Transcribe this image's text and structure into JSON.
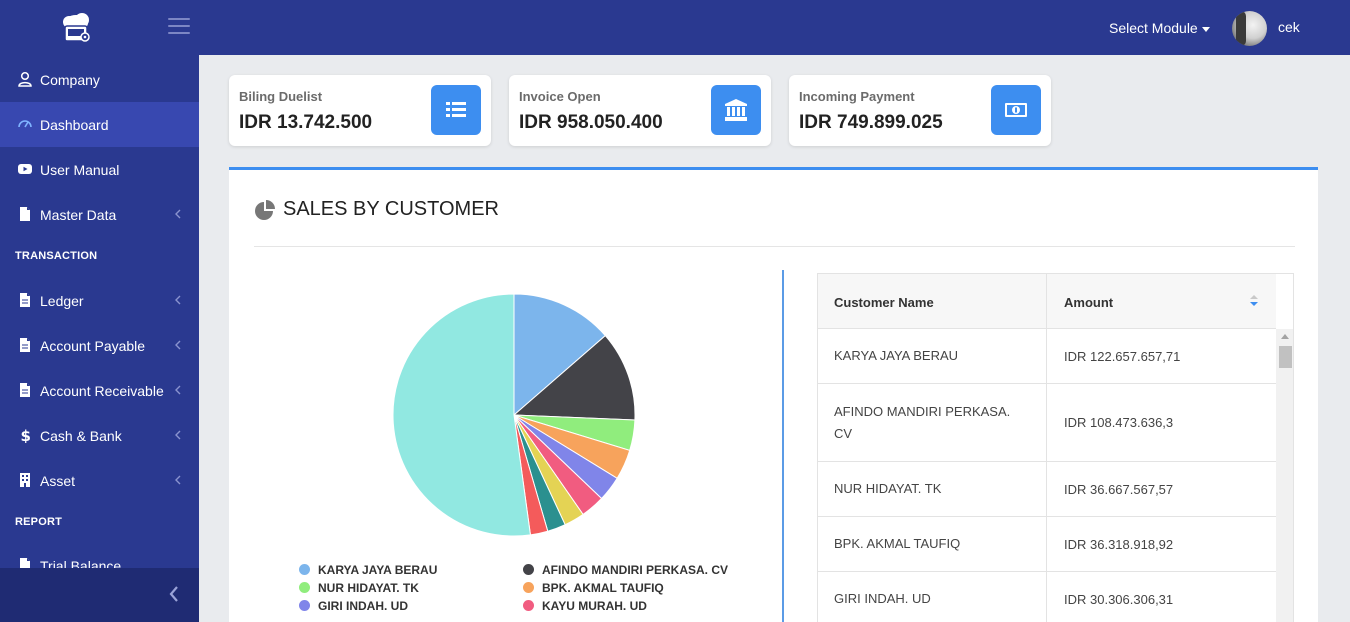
{
  "header": {
    "module_select": "Select Module",
    "username": "cek"
  },
  "sidebar": {
    "items": [
      {
        "label": "Company",
        "icon": "user-icon"
      },
      {
        "label": "Dashboard",
        "icon": "dashboard-icon",
        "active": true
      },
      {
        "label": "User Manual",
        "icon": "youtube-icon"
      },
      {
        "label": "Master Data",
        "icon": "file-icon"
      },
      {
        "label": "Ledger",
        "icon": "file-icon"
      },
      {
        "label": "Account Payable",
        "icon": "file-icon"
      },
      {
        "label": "Account Receivable",
        "icon": "file-icon"
      },
      {
        "label": "Cash & Bank",
        "icon": "dollar-icon"
      },
      {
        "label": "Asset",
        "icon": "building-icon"
      },
      {
        "label": "Trial Balance",
        "icon": "file-icon"
      }
    ],
    "sections": [
      "TRANSACTION",
      "REPORT"
    ]
  },
  "cards": [
    {
      "title": "Biling Duelist",
      "value": "IDR 13.742.500",
      "icon": "list-icon"
    },
    {
      "title": "Invoice Open",
      "value": "IDR 958.050.400",
      "icon": "bank-icon"
    },
    {
      "title": "Incoming Payment",
      "value": "IDR 749.899.025",
      "icon": "money-icon"
    }
  ],
  "panel": {
    "title": "SALES BY CUSTOMER"
  },
  "table": {
    "columns": [
      "Customer Name",
      "Amount"
    ],
    "rows": [
      {
        "name": "KARYA JAYA BERAU",
        "amount": "IDR 122.657.657,71"
      },
      {
        "name": "AFINDO MANDIRI PERKASA. CV",
        "amount": "IDR 108.473.636,3"
      },
      {
        "name": "NUR HIDAYAT. TK",
        "amount": "IDR 36.667.567,57"
      },
      {
        "name": "BPK. AKMAL TAUFIQ",
        "amount": "IDR 36.318.918,92"
      },
      {
        "name": "GIRI INDAH. UD",
        "amount": "IDR 30.306.306,31"
      }
    ]
  },
  "colors": {
    "topbar": "#2a3990",
    "accent": "#3d8ef0"
  },
  "chart_data": {
    "type": "pie",
    "title": "",
    "slices": [
      {
        "label": "KARYA JAYA BERAU",
        "value": 122657657.71,
        "color": "#7cb5ec"
      },
      {
        "label": "AFINDO MANDIRI PERKASA. CV",
        "value": 108473636.3,
        "color": "#434348"
      },
      {
        "label": "NUR HIDAYAT. TK",
        "value": 36667567.57,
        "color": "#90ed7d"
      },
      {
        "label": "BPK. AKMAL TAUFIQ",
        "value": 36318918.92,
        "color": "#f7a35c"
      },
      {
        "label": "GIRI INDAH. UD",
        "value": 30306306.31,
        "color": "#8085e9"
      },
      {
        "label": "KAYU MURAH. UD",
        "value": 29000000,
        "color": "#f15c80"
      },
      {
        "label": "",
        "value": 24500000,
        "color": "#e4d354"
      },
      {
        "label": "",
        "value": 22000000,
        "color": "#2b908f"
      },
      {
        "label": "",
        "value": 21000000,
        "color": "#f45b5b"
      },
      {
        "label": "",
        "value": 470000000,
        "color": "#91e8e1"
      }
    ]
  }
}
